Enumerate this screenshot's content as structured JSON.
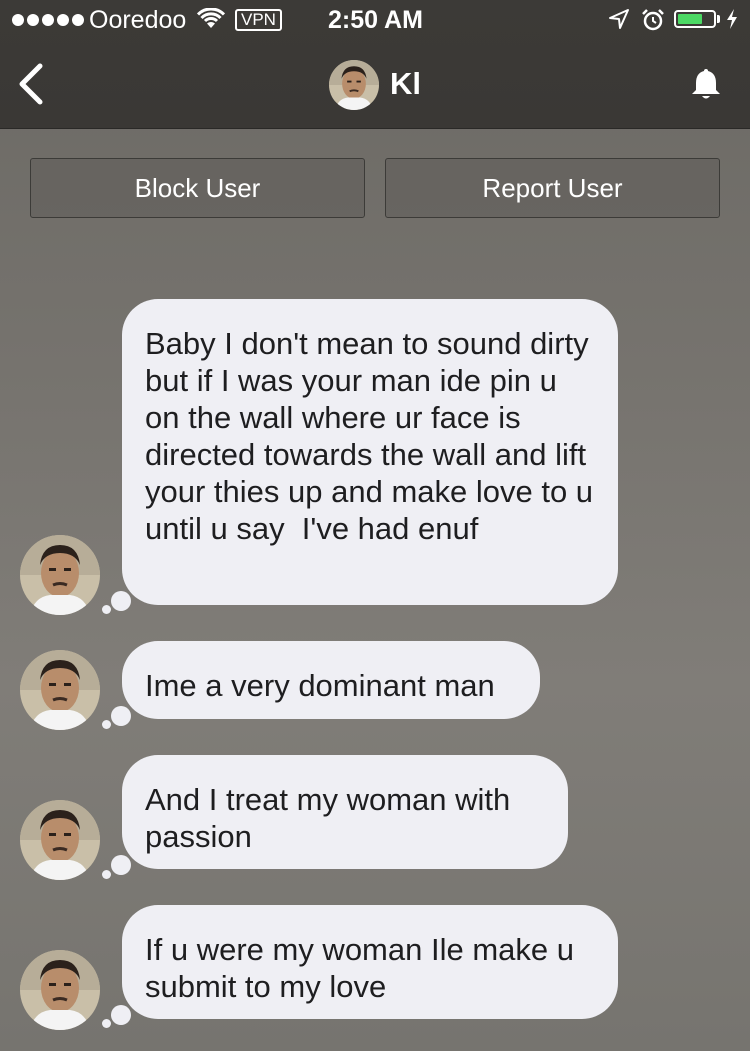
{
  "status_bar": {
    "carrier": "Ooredoo",
    "vpn": "VPN",
    "time": "2:50 AM",
    "battery_level": 0.72,
    "battery_color": "#4cd964"
  },
  "nav": {
    "back_icon": "chevron-left-icon",
    "title": "Kl",
    "bell_icon": "bell-icon"
  },
  "actions": {
    "block_label": "Block User",
    "report_label": "Report User"
  },
  "messages": [
    {
      "text": "Baby I don't mean to sound dirty but if I was your man ide pin u on the wall where ur face is directed towards the wall and lift your thies up and make love to u until u say  I've had enuf"
    },
    {
      "text": "Ime a very dominant man"
    },
    {
      "text": "And I treat my woman with passion"
    },
    {
      "text": "If u were my woman Ile make u submit to my love"
    }
  ],
  "colors": {
    "header": "#3c3a37",
    "bubble": "#efeff4",
    "bubble_text": "#1e1e20"
  }
}
